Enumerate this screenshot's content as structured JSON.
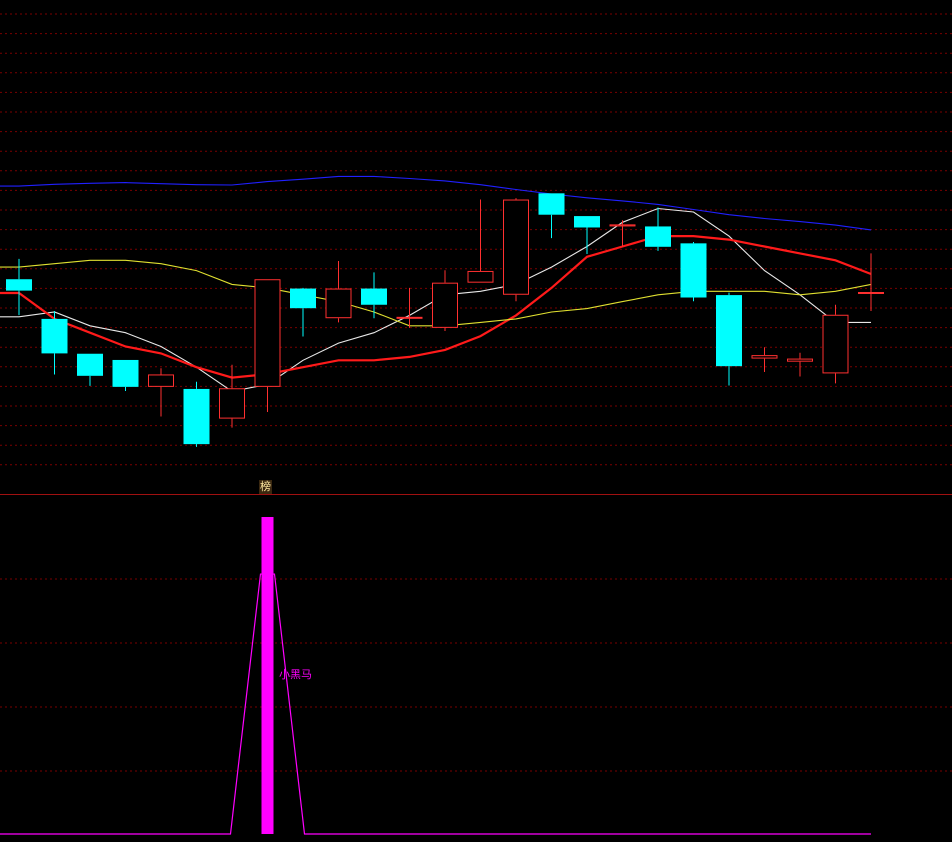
{
  "badge_label": "榜",
  "colors": {
    "background": "#000000",
    "grid": "#7a0000",
    "divider": "#a01010",
    "up_candle": "#ff3030",
    "down_candle": "#00ffff",
    "ma_white": "#e8e8e8",
    "ma_red": "#ff1a1a",
    "ma_yellow": "#e0e030",
    "ma_blue": "#2020ff",
    "signal": "#ff00ff"
  },
  "chart_data": [
    {
      "type": "candlestick",
      "name": "price",
      "ylim": [
        0,
        100
      ],
      "grid": true,
      "candles": [
        {
          "o": 49.5,
          "c": 46.2,
          "h": 55.4,
          "l": 39.1
        },
        {
          "o": 38.0,
          "c": 28.0,
          "h": 40.3,
          "l": 21.9
        },
        {
          "o": 27.9,
          "c": 21.5,
          "h": 27.9,
          "l": 18.6
        },
        {
          "o": 26.1,
          "c": 18.3,
          "h": 26.1,
          "l": 17.1
        },
        {
          "o": 18.3,
          "c": 21.9,
          "h": 23.7,
          "l": 9.7
        },
        {
          "o": 17.7,
          "c": 1.7,
          "h": 19.8,
          "l": 0.9
        },
        {
          "o": 9.1,
          "c": 17.9,
          "h": 24.7,
          "l": 6.5
        },
        {
          "o": 18.3,
          "c": 49.5,
          "h": 49.5,
          "l": 11.0
        },
        {
          "o": 46.8,
          "c": 41.1,
          "h": 47.0,
          "l": 32.9
        },
        {
          "o": 38.2,
          "c": 46.8,
          "h": 54.8,
          "l": 37.0
        },
        {
          "o": 46.8,
          "c": 42.1,
          "h": 51.5,
          "l": 38.2
        },
        {
          "o": 38.2,
          "c": 38.6,
          "h": 47.0,
          "l": 35.4
        },
        {
          "o": 35.4,
          "c": 48.5,
          "h": 52.1,
          "l": 34.5
        },
        {
          "o": 48.5,
          "c": 51.9,
          "h": 72.6,
          "l": 48.5
        },
        {
          "o": 45.0,
          "c": 72.6,
          "h": 73.0,
          "l": 43.1
        },
        {
          "o": 74.4,
          "c": 68.2,
          "h": 74.4,
          "l": 61.4
        },
        {
          "o": 67.8,
          "c": 64.5,
          "h": 67.8,
          "l": 56.8
        },
        {
          "o": 64.8,
          "c": 65.4,
          "h": 66.6,
          "l": 58.9
        },
        {
          "o": 64.8,
          "c": 58.9,
          "h": 70.3,
          "l": 57.7
        },
        {
          "o": 59.9,
          "c": 44.2,
          "h": 60.3,
          "l": 43.1
        },
        {
          "o": 44.9,
          "c": 24.3,
          "h": 45.6,
          "l": 18.7
        },
        {
          "o": 26.5,
          "c": 27.5,
          "h": 29.8,
          "l": 22.6
        },
        {
          "o": 25.6,
          "c": 26.5,
          "h": 28.2,
          "l": 21.3
        },
        {
          "o": 22.2,
          "c": 39.2,
          "h": 42.1,
          "l": 19.3
        },
        {
          "o": 45.6,
          "c": 45.8,
          "h": 57.0,
          "l": 40.3
        }
      ],
      "moving_averages": [
        {
          "color_key": "ma_white",
          "values": [
            38.6,
            40.0,
            36.0,
            34.0,
            30.0,
            24.0,
            17.0,
            19.0,
            26.0,
            31.0,
            34.0,
            39.0,
            45.0,
            46.0,
            48.0,
            53.0,
            59.0,
            66.0,
            70.0,
            69.0,
            62.0,
            52.0,
            45.0,
            37.0,
            37.0
          ]
        },
        {
          "color_key": "ma_red",
          "values": [
            45.5,
            38.0,
            34.0,
            30.0,
            28.0,
            24.0,
            21.0,
            22.0,
            24.0,
            26.0,
            26.0,
            27.0,
            29.0,
            33.0,
            39.0,
            47.0,
            56.0,
            59.0,
            62.0,
            62.0,
            61.0,
            59.0,
            57.0,
            55.0,
            51.0
          ]
        },
        {
          "color_key": "ma_yellow",
          "values": [
            53.0,
            54.0,
            55.0,
            55.0,
            54.0,
            52.0,
            48.0,
            47.0,
            45.0,
            43.0,
            40.0,
            36.0,
            36.0,
            37.0,
            38.0,
            40.0,
            41.0,
            43.0,
            45.0,
            46.0,
            46.0,
            46.0,
            45.0,
            46.0,
            48.0
          ]
        },
        {
          "color_key": "ma_blue",
          "values": [
            76.5,
            77.0,
            77.3,
            77.5,
            77.2,
            76.9,
            76.8,
            77.8,
            78.5,
            79.3,
            79.3,
            78.7,
            78.0,
            76.9,
            75.5,
            74.2,
            73.1,
            72.2,
            71.2,
            69.7,
            68.2,
            67.1,
            66.2,
            65.2,
            63.8
          ]
        }
      ]
    },
    {
      "type": "bar",
      "name": "signal",
      "ylim": [
        0,
        100
      ],
      "grid": true,
      "label": "小黑马",
      "line_values": [
        0,
        0,
        0,
        0,
        0,
        0,
        0,
        100,
        0,
        0,
        0,
        0,
        0,
        0,
        0,
        0,
        0,
        0,
        0,
        0,
        0,
        0,
        0,
        0,
        0
      ],
      "bar_values": [
        0,
        0,
        0,
        0,
        0,
        0,
        0,
        100,
        0,
        0,
        0,
        0,
        0,
        0,
        0,
        0,
        0,
        0,
        0,
        0,
        0,
        0,
        0,
        0,
        0
      ]
    }
  ]
}
